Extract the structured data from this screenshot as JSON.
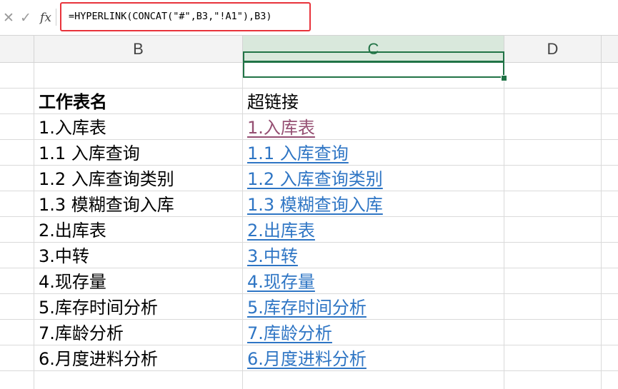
{
  "formula_bar": {
    "cancel_icon": "✕",
    "enter_icon": "✓",
    "fx_label": "fx",
    "formula": "=HYPERLINK(CONCAT(\"#\",B3,\"!A1\"),B3)",
    "highlight_color": "#e8333b"
  },
  "columns": [
    {
      "label": "B",
      "selected": false
    },
    {
      "label": "C",
      "selected": true
    },
    {
      "label": "D",
      "selected": false
    }
  ],
  "table": {
    "header_b": "工作表名",
    "header_c": "超链接",
    "rows": [
      {
        "name": "1.入库表",
        "link": "1.入库表",
        "visited": true
      },
      {
        "name": "1.1 入库查询",
        "link": "1.1 入库查询",
        "visited": false
      },
      {
        "name": "1.2 入库查询类别",
        "link": "1.2 入库查询类别",
        "visited": false
      },
      {
        "name": "1.3 模糊查询入库",
        "link": "1.3 模糊查询入库",
        "visited": false
      },
      {
        "name": "2.出库表",
        "link": "2.出库表",
        "visited": false
      },
      {
        "name": "3.中转",
        "link": "3.中转",
        "visited": false
      },
      {
        "name": "4.现存量",
        "link": "4.现存量",
        "visited": false
      },
      {
        "name": "5.库存时间分析",
        "link": "5.库存时间分析",
        "visited": false
      },
      {
        "name": "7.库龄分析",
        "link": "7.库龄分析",
        "visited": false
      },
      {
        "name": "6.月度进料分析",
        "link": "6.月度进料分析",
        "visited": false
      }
    ]
  },
  "colors": {
    "link": "#2e75c4",
    "visited_link": "#954f72",
    "selection": "#217346"
  }
}
